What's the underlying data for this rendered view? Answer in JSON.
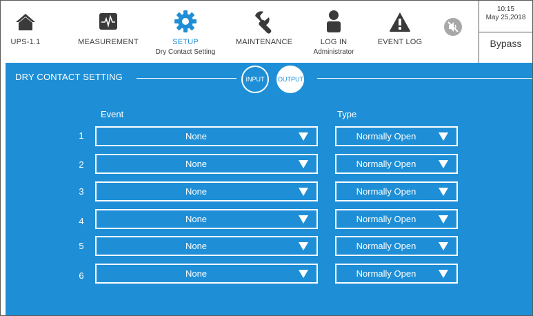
{
  "nav": {
    "items": [
      {
        "label": "UPS-1.1",
        "sub": "",
        "icon": "home-icon"
      },
      {
        "label": "MEASUREMENT",
        "sub": "",
        "icon": "waveform-icon"
      },
      {
        "label": "SETUP",
        "sub": "Dry Contact Setting",
        "icon": "gear-icon"
      },
      {
        "label": "MAINTENANCE",
        "sub": "",
        "icon": "wrench-icon"
      },
      {
        "label": "LOG IN",
        "sub": "Administrator",
        "icon": "user-icon"
      },
      {
        "label": "EVENT LOG",
        "sub": "",
        "icon": "warning-icon"
      }
    ],
    "mute_icon": "speaker-muted-icon",
    "active_color": "#1e8fd6"
  },
  "status": {
    "time": "10:15",
    "date": "May 25,2018",
    "mode": "Bypass"
  },
  "page": {
    "title": "DRY CONTACT SETTING",
    "input_button": "INPUT",
    "output_button": "OUTPUT",
    "selected_tab": "OUTPUT",
    "event_header": "Event",
    "type_header": "Type",
    "background_color": "#1e8fd6"
  },
  "rows": [
    {
      "num": "1",
      "event": "None",
      "type": "Normally Open"
    },
    {
      "num": "2",
      "event": "None",
      "type": "Normally Open"
    },
    {
      "num": "3",
      "event": "None",
      "type": "Normally Open"
    },
    {
      "num": "4",
      "event": "None",
      "type": "Normally Open"
    },
    {
      "num": "5",
      "event": "None",
      "type": "Normally Open"
    },
    {
      "num": "6",
      "event": "None",
      "type": "Normally Open"
    }
  ]
}
